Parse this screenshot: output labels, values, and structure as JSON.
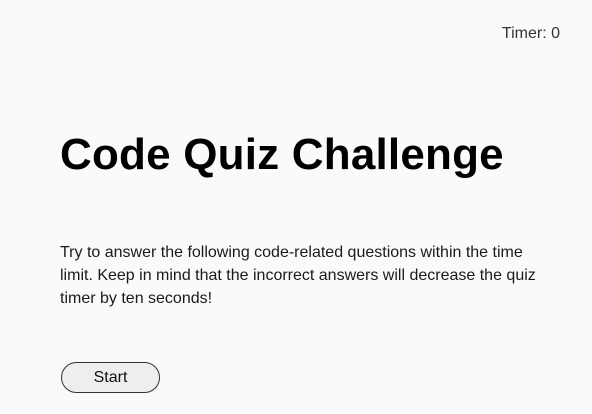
{
  "header": {
    "timer_label": "Timer: ",
    "timer_value": "0"
  },
  "main": {
    "title": "Code Quiz Challenge",
    "intro": "Try to answer the following code-related questions within the time limit. Keep in mind that the incorrect answers will decrease the quiz timer by ten seconds!",
    "start_label": "Start"
  }
}
